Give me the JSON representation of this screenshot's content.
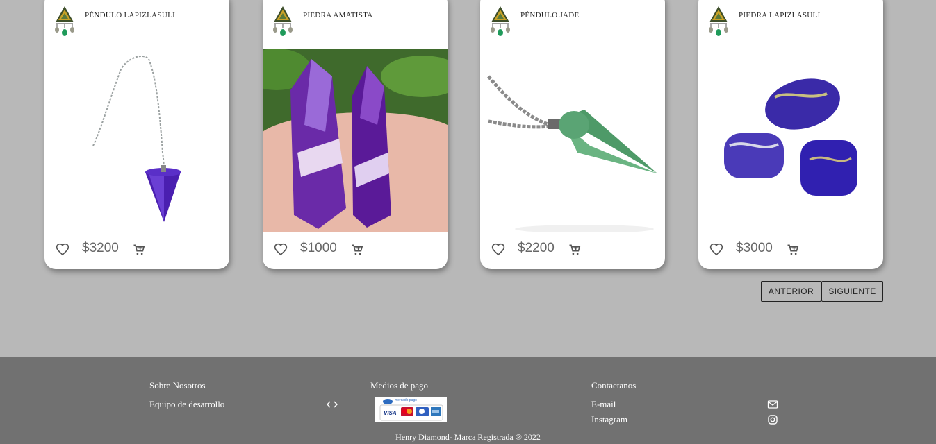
{
  "products": [
    {
      "name": "PÉNDULO LAPIZLASULI",
      "price": "$3200",
      "image": "purple-pendulum-on-chain"
    },
    {
      "name": "PIEDRA AMATISTA",
      "price": "$1000",
      "image": "amethyst-crystal-points-in-hand"
    },
    {
      "name": "PÉNDULO JADE",
      "price": "$2200",
      "image": "green-jade-pendulum"
    },
    {
      "name": "PIEDRA LAPIZLASULI",
      "price": "$3000",
      "image": "lapis-lazuli-tumbled-stones"
    }
  ],
  "pagination": {
    "prev_label": "ANTERIOR",
    "next_label": "SIGUIENTE"
  },
  "footer": {
    "about": {
      "heading": "Sobre Nosotros",
      "items": [
        {
          "label": "Equipo de desarrollo",
          "icon": "code-icon"
        }
      ]
    },
    "payment": {
      "heading": "Medios de pago",
      "logo": "mercado-pago-cards-logo",
      "logo_text": "mercado pago",
      "cards": [
        "VISA",
        "MasterCard",
        "Diners",
        "AMEX"
      ]
    },
    "contact": {
      "heading": "Contactanos",
      "items": [
        {
          "label": "E-mail",
          "icon": "mail-icon"
        },
        {
          "label": "Instagram",
          "icon": "instagram-icon"
        }
      ]
    },
    "copyright": "Henry Diamond- Marca Registrada ® 2022"
  },
  "colors": {
    "page_bg": "#b8b8b8",
    "footer_bg": "#717171",
    "card_bg": "#ffffff",
    "price_text": "#666666"
  }
}
